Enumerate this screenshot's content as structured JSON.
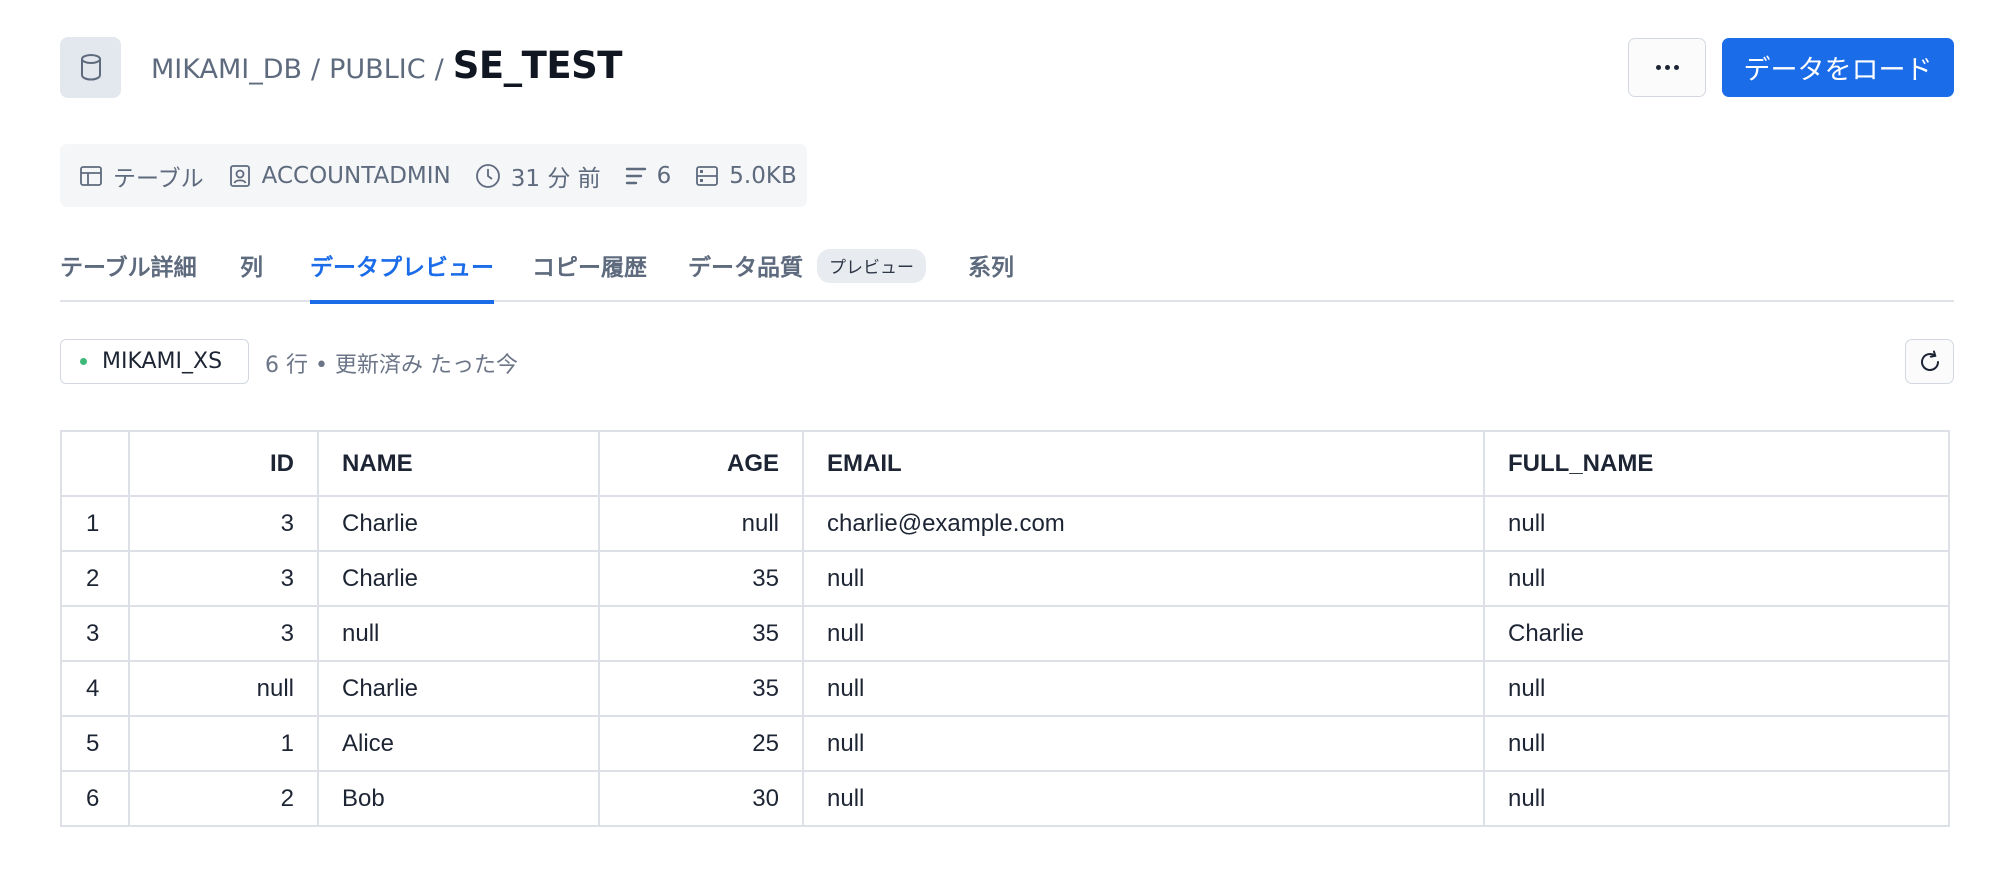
{
  "header": {
    "icon": "database-icon",
    "breadcrumb": {
      "database": "MIKAMI_DB",
      "separator": "/",
      "schema": "PUBLIC",
      "table": "SE_TEST"
    },
    "more_icon": "ellipsis-icon",
    "load_button_label": "データをロード"
  },
  "meta": {
    "type_label": "テーブル",
    "owner": "ACCOUNTADMIN",
    "updated": "31 分 前",
    "row_count": "6",
    "size": "5.0KB"
  },
  "tabs": [
    {
      "label": "テーブル詳細",
      "active": false
    },
    {
      "label": "列",
      "active": false
    },
    {
      "label": "データプレビュー",
      "active": true
    },
    {
      "label": "コピー履歴",
      "active": false
    },
    {
      "label": "データ品質",
      "active": false,
      "badge": "プレビュー"
    },
    {
      "label": "系列",
      "active": false
    }
  ],
  "warehouse": {
    "name": "MIKAMI_XS",
    "status_color": "#3cb878",
    "row_status": "6 行 • 更新済み たった今"
  },
  "table": {
    "columns": [
      "",
      "ID",
      "NAME",
      "AGE",
      "EMAIL",
      "FULL_NAME"
    ],
    "rows": [
      [
        "1",
        "3",
        "Charlie",
        "null",
        "charlie@example.com",
        "null"
      ],
      [
        "2",
        "3",
        "Charlie",
        "35",
        "null",
        "null"
      ],
      [
        "3",
        "3",
        "null",
        "35",
        "null",
        "Charlie"
      ],
      [
        "4",
        "null",
        "Charlie",
        "35",
        "null",
        "null"
      ],
      [
        "5",
        "1",
        "Alice",
        "25",
        "null",
        "null"
      ],
      [
        "6",
        "2",
        "Bob",
        "30",
        "null",
        "null"
      ]
    ]
  },
  "colors": {
    "accent": "#1a6ce8",
    "text": "#1d2433",
    "muted": "#5e6a7d"
  }
}
